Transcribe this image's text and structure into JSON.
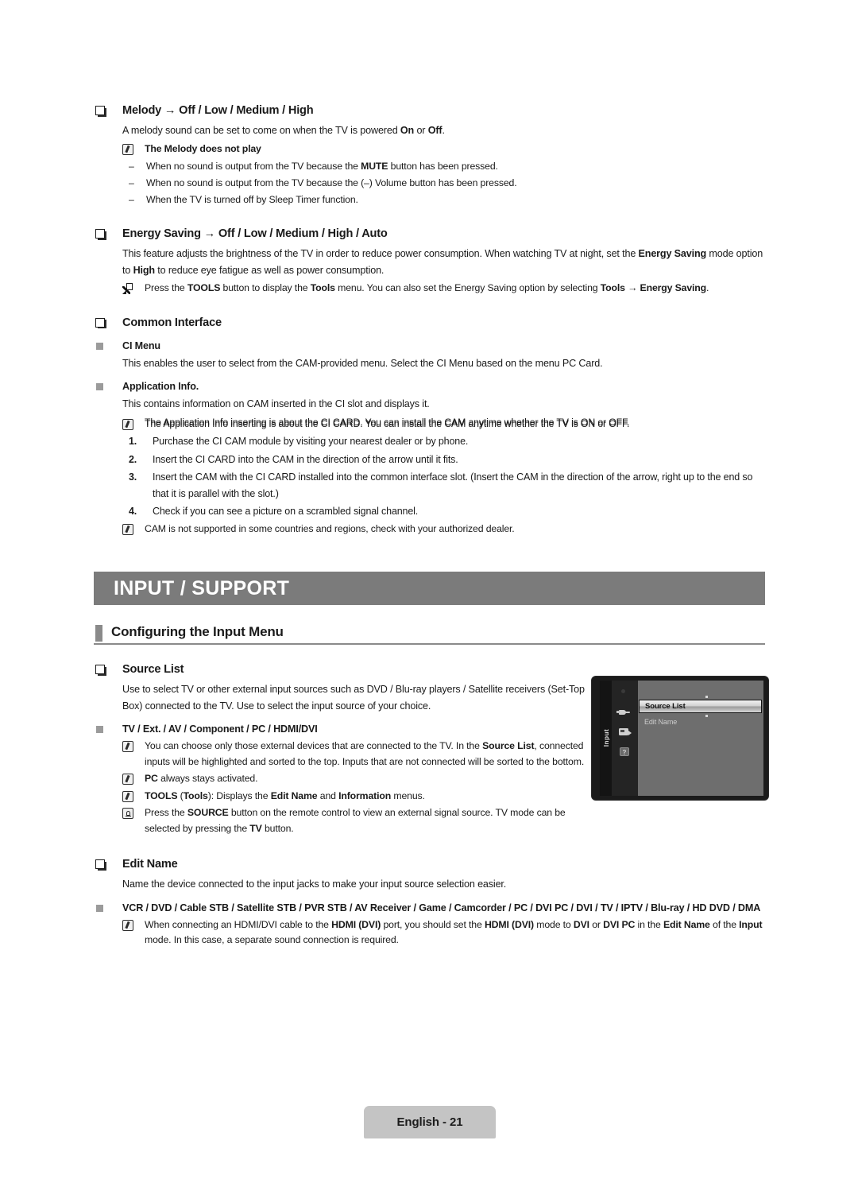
{
  "document": {
    "page_label": "English - 21"
  },
  "sections": {
    "melody": {
      "heading": "Melody → Off / Low / Medium / High",
      "paragraph": "A melody sound can be set to come on when the TV is powered On or Off.",
      "note_title": "The Melody does not play",
      "dashes": [
        "When no sound is output from the TV because the MUTE button has been pressed.",
        "When no sound is output from the TV because the (–) Volume button has been pressed.",
        "When the TV is turned off by Sleep Timer function."
      ]
    },
    "energy_saving": {
      "heading": "Energy Saving → Off / Low / Medium / High / Auto",
      "paragraph": "This feature adjusts the brightness of the TV in order to reduce power consumption. When watching TV at night, set the Energy Saving mode option to High to reduce eye fatigue as well as power consumption.",
      "tools_note": "Press the TOOLS button to display the Tools menu. You can also set the Energy Saving option by selecting Tools → Energy Saving."
    },
    "common_interface": {
      "heading": "Common Interface",
      "ci_menu_label": "CI Menu",
      "ci_menu_text": "This enables the user to select from the CAM-provided menu. Select the CI Menu based on the menu PC Card.",
      "app_info_label": "Application Info.",
      "app_info_text": "This contains information on CAM inserted in the CI slot and displays it.",
      "app_info_note": "The Application Info inserting is about the CI CARD. You can install the CAM anytime whether the TV is ON or OFF.",
      "steps": [
        {
          "n": "1.",
          "text": "Purchase the CI CAM module by visiting your nearest dealer or by phone."
        },
        {
          "n": "2.",
          "text": "Insert the CI CARD into the CAM in the direction of the arrow until it fits."
        },
        {
          "n": "3.",
          "text": "Insert the CAM with the CI CARD installed into the common interface slot. (Insert the CAM in the direction of the arrow, right up to the end so that it is parallel with the slot.)"
        },
        {
          "n": "4.",
          "text": "Check if you can see a picture on a scrambled signal channel."
        }
      ],
      "final_note": "CAM is not supported in some countries and regions, check with your authorized dealer."
    },
    "banner": {
      "title": "INPUT / SUPPORT"
    },
    "subhead": {
      "title": "Configuring the Input Menu"
    },
    "source_list": {
      "heading": "Source List",
      "paragraph": "Use to select TV or other external input sources such as DVD / Blu-ray players / Satellite receivers (Set-Top Box) connected to the TV. Use to select the input source of your choice.",
      "square_label": "TV / Ext. / AV / Component / PC / HDMI/DVI",
      "note_1": "You can choose only those external devices that are connected to the TV. In the Source List, connected inputs will be highlighted and sorted to the top. Inputs that are not connected will be sorted to the bottom.",
      "note_2": "PC always stays activated.",
      "note_3": "TOOLS (Tools): Displays the Edit Name and Information menus.",
      "note_4": "Press the SOURCE button on the remote control to view an external signal source. TV mode can be selected by pressing the TV button."
    },
    "edit_name": {
      "heading": "Edit Name",
      "paragraph": "Name the device connected to the input jacks to make your input source selection easier.",
      "square_label": "VCR / DVD / Cable STB / Satellite STB / PVR STB / AV Receiver / Game / Camcorder / PC / DVI PC / DVI / TV / IPTV / Blu-ray / HD DVD / DMA",
      "note_1": "When connecting an HDMI/DVI cable to the HDMI (DVI) port, you should set the HDMI (DVI) mode to DVI or DVI PC in the Edit Name of the Input mode. In this case, a separate sound connection is required."
    }
  },
  "osd": {
    "tab_label": "Input",
    "selected_item": "Source List",
    "second_item": "Edit Name",
    "icons": [
      "gear-icon",
      "plug-icon",
      "card-icon",
      "question-icon"
    ]
  },
  "colors": {
    "banner_bg": "#7b7b7b",
    "rule": "#8a8a8a",
    "square_bullet": "#9b9b9b",
    "footer_bg": "#c4c4c4",
    "osd_bg": "#6e6e6e"
  }
}
